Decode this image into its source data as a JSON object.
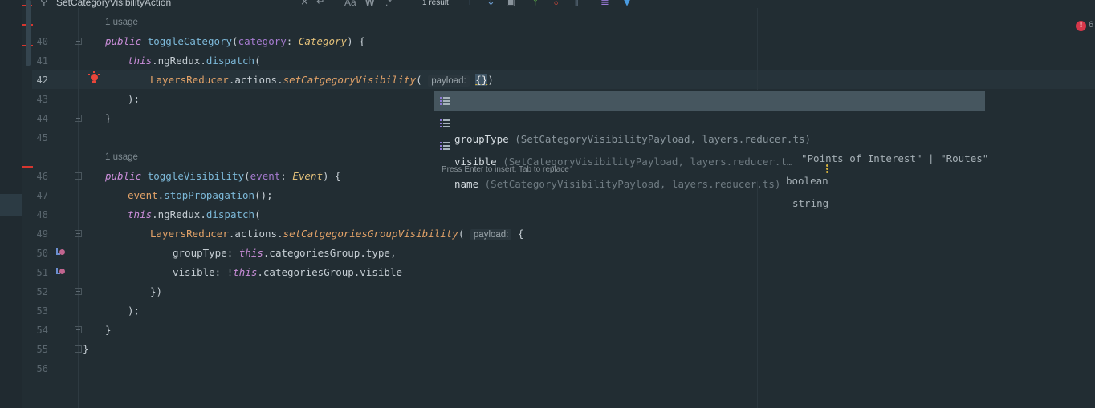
{
  "find_bar": {
    "query": "SetCategoryVisibilityAction",
    "close": "×",
    "enter": "↵",
    "match_case": "Aa",
    "words": "W",
    "regex": ".*",
    "results": "1 result",
    "prev_icon": "up-arrow-icon",
    "next_icon": "down-arrow-icon"
  },
  "usages": [
    "1 usage",
    "1 usage"
  ],
  "lines": {
    "n40": "40",
    "n41": "41",
    "n42": "42",
    "n43": "43",
    "n44": "44",
    "n45": "45",
    "n46": "46",
    "n47": "47",
    "n48": "48",
    "n49": "49",
    "n50": "50",
    "n51": "51",
    "n52": "52",
    "n53": "53",
    "n54": "54",
    "n55": "55",
    "n56": "56"
  },
  "code": {
    "l40": {
      "kw": "public",
      "fn": "toggleCategory",
      "p1": "(",
      "par": "category",
      "c": ": ",
      "ty": "Category",
      "p2": ") {"
    },
    "l41": {
      "kw": "this",
      "rest": ".ngRedux.",
      "fn": "dispatch",
      "p": "("
    },
    "l42": {
      "cls": "LayersReducer",
      "d1": ".",
      "prop": "actions",
      "d2": ".",
      "mth": "setCatgegoryVisibility",
      "p": "( ",
      "hint": "payload:",
      "sp": " ",
      "brace": "{}",
      "close": ")"
    },
    "l43": ");",
    "l44": "}",
    "l46": {
      "kw": "public",
      "fn": "toggleVisibility",
      "p1": "(",
      "par": "event",
      "c": ": ",
      "ty": "Event",
      "p2": ") {"
    },
    "l47": {
      "obj": "event",
      "d": ".",
      "fn": "stopPropagation",
      "p": "();"
    },
    "l48": {
      "kw": "this",
      "rest": ".ngRedux.",
      "fn": "dispatch",
      "p": "("
    },
    "l49": {
      "cls": "LayersReducer",
      "d1": ".",
      "prop": "actions",
      "d2": ".",
      "mth": "setCatgegoriesGroupVisibility",
      "p": "( ",
      "hint": "payload:",
      "brace": " {"
    },
    "l50": {
      "key": "groupType: ",
      "kw": "this",
      "rest": ".categoriesGroup.type,"
    },
    "l51": {
      "key": "visible: !",
      "kw": "this",
      "rest": ".categoriesGroup.visible"
    },
    "l52": "})",
    "l53": ");",
    "l54": "}",
    "l55": "}"
  },
  "completion": {
    "items": [
      {
        "name": "groupType",
        "location": "(SetCategoryVisibilityPayload, layers.reducer.ts)",
        "type": "\"Points of Interest\" | \"Routes\""
      },
      {
        "name": "visible",
        "location": "(SetCategoryVisibilityPayload, layers.reducer.t…",
        "type": "boolean"
      },
      {
        "name": "name",
        "location": "(SetCategoryVisibilityPayload, layers.reducer.ts)",
        "type": "string"
      }
    ],
    "hint": "Press Enter to insert, Tab to replace"
  },
  "status": {
    "errors_count": "6",
    "error_mark": "!"
  },
  "colors": {
    "background": "#222d33",
    "error": "#d6374a",
    "keyword": "#c98dd8",
    "selection": "#46565f"
  }
}
